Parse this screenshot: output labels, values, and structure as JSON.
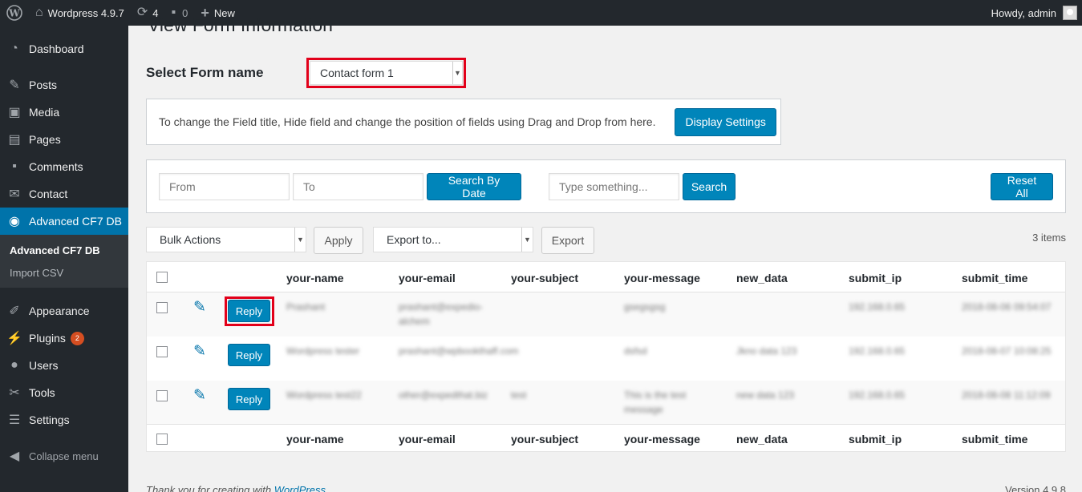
{
  "adminbar": {
    "site_name": "Wordpress 4.9.7",
    "updates_count": "4",
    "comments_count": "0",
    "new_label": "New",
    "greeting": "Howdy, admin"
  },
  "sidebar": {
    "items": [
      {
        "label": "Dashboard",
        "icon": "dashboard-icon"
      },
      {
        "label": "Posts",
        "icon": "pin-icon"
      },
      {
        "label": "Media",
        "icon": "media-icon"
      },
      {
        "label": "Pages",
        "icon": "pages-icon"
      },
      {
        "label": "Comments",
        "icon": "comment-icon"
      },
      {
        "label": "Contact",
        "icon": "envelope-icon"
      },
      {
        "label": "Advanced CF7 DB",
        "icon": "eye-icon"
      },
      {
        "label": "Appearance",
        "icon": "brush-icon"
      },
      {
        "label": "Plugins",
        "icon": "plug-icon",
        "badge": "2"
      },
      {
        "label": "Users",
        "icon": "user-icon"
      },
      {
        "label": "Tools",
        "icon": "wrench-icon"
      },
      {
        "label": "Settings",
        "icon": "sliders-icon"
      }
    ],
    "submenu": [
      "Advanced CF7 DB",
      "Import CSV"
    ],
    "collapse_label": "Collapse menu"
  },
  "page": {
    "title": "View Form Information",
    "select_label": "Select Form name",
    "selected_form": "Contact form 1",
    "notice_text": "To change the Field title, Hide field and change the position of fields using Drag and Drop from here.",
    "display_settings_label": "Display Settings"
  },
  "filters": {
    "from_placeholder": "From",
    "to_placeholder": "To",
    "search_by_date_label": "Search By Date",
    "search_placeholder": "Type something...",
    "search_label": "Search",
    "reset_label": "Reset All"
  },
  "tablenav": {
    "bulk_actions": "Bulk Actions",
    "apply_label": "Apply",
    "export_to": "Export to...",
    "export_label": "Export",
    "items_count": "3 items"
  },
  "table": {
    "columns": [
      "your-name",
      "your-email",
      "your-subject",
      "your-message",
      "new_data",
      "submit_ip",
      "submit_time"
    ],
    "reply_label": "Reply",
    "rows": [
      {
        "name": "Prashant",
        "email": "prashant@expedio-alchem",
        "subject": "",
        "message": "gsegsgsg",
        "new_data": "",
        "ip": "192.168.0.65",
        "time": "2018-08-06 09:54:07"
      },
      {
        "name": "Wordpress tester",
        "email": "prashant@wpbookthaff.com",
        "subject": "",
        "message": "dsfsd",
        "new_data": "Jkno data 123",
        "ip": "192.168.0.65",
        "time": "2018-08-07 10:08:25"
      },
      {
        "name": "Wordpress test22",
        "email": "other@expedthat.biz",
        "subject": "test",
        "message": "This is the test message",
        "new_data": "new data 123",
        "ip": "192.168.0.65",
        "time": "2018-08-08 11:12:09"
      }
    ]
  },
  "footer": {
    "thanks_prefix": "Thank you for creating with",
    "wordpress_link": "WordPress",
    "version": "Version 4.9.8"
  }
}
